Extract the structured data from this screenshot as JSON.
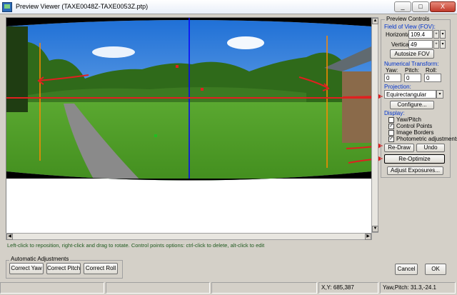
{
  "window": {
    "title": "Preview Viewer (TAXE0048Z-TAXE0053Z.ptp)",
    "min_label": "_",
    "max_label": "□",
    "close_label": "X"
  },
  "hint": "Left-click to reposition, right-click and drag to rotate. Control points options: ctrl-click to delete, alt-click to edit",
  "controls": {
    "title": "Preview Controls",
    "fov_label": "Field of View (FOV):",
    "horizontal_label": "Horizontal:",
    "horizontal_value": "109.4",
    "vertical_label": "Vertical:",
    "vertical_value": "49",
    "autosize_label": "Autosize FOV",
    "numerical_label": "Numerical Transform:",
    "yaw_label": "Yaw:",
    "pitch_label": "Pitch:",
    "roll_label": "Roll:",
    "yaw_value": "0",
    "pitch_value": "0",
    "roll_value": "0",
    "projection_label": "Projection:",
    "projection_value": "Equirectangular",
    "configure_label": "Configure...",
    "display_label": "Display:",
    "display_items": [
      {
        "label": "Yaw/Pitch",
        "checked": false
      },
      {
        "label": "Control Points",
        "checked": true
      },
      {
        "label": "Image Borders",
        "checked": false
      },
      {
        "label": "Photometric adjustments",
        "checked": true
      }
    ],
    "redraw_label": "Re-Draw",
    "undo_label": "Undo",
    "reoptimize_label": "Re-Optimize",
    "adjust_label": "Adjust Exposures..."
  },
  "auto": {
    "title": "Automatic Adjustments",
    "yaw_label": "Correct Yaw",
    "pitch_label": "Correct Pitch",
    "roll_label": "Correct Roll"
  },
  "dialog": {
    "cancel_label": "Cancel",
    "ok_label": "OK"
  },
  "status": {
    "xy": "X,Y: 685,387",
    "yawpitch": "Yaw,Pitch: 31.3,-24.1"
  },
  "colors": {
    "accent_blue": "#0033cc",
    "annotation_red": "#e02020",
    "guide_orange": "#ff8a00",
    "center_blue": "#0000ff"
  }
}
